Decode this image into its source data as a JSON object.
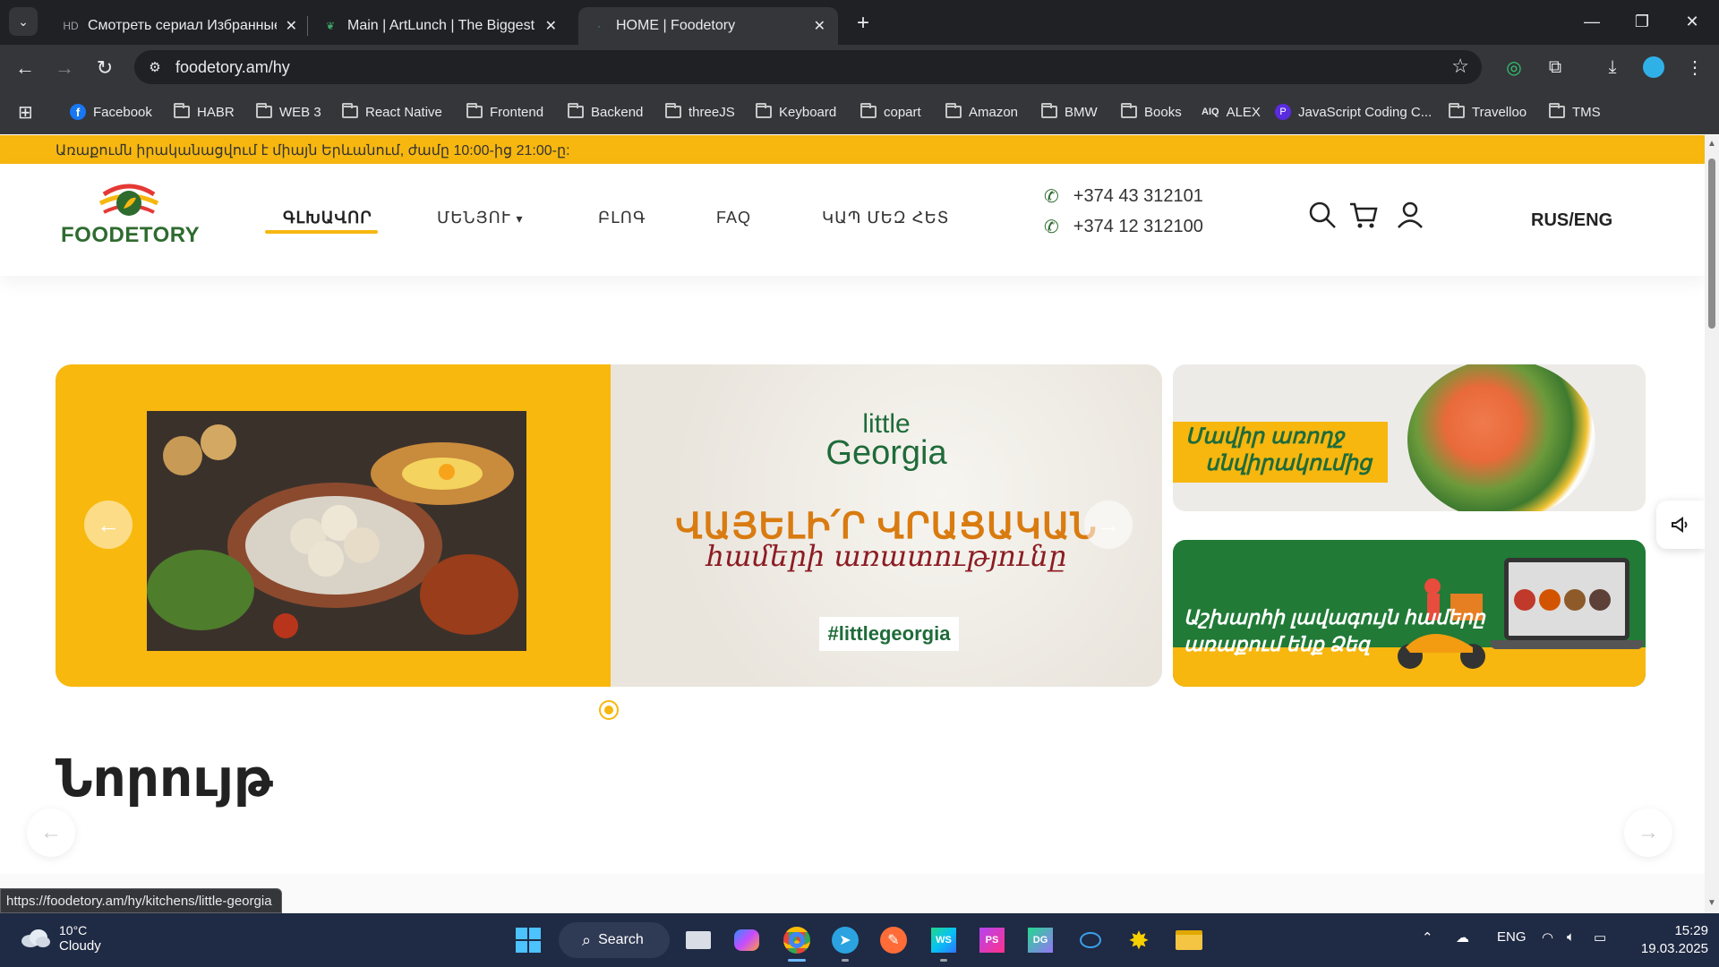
{
  "browser": {
    "tabs": [
      {
        "title": "Смотреть сериал Избранные с",
        "favicon": "hd-icon",
        "active": false
      },
      {
        "title": "Main | ArtLunch | The Biggest C",
        "favicon": "artlunch-icon",
        "active": false
      },
      {
        "title": "HOME | Foodetory",
        "favicon": "foodetory-icon",
        "active": true
      }
    ],
    "url": "foodetory.am/hy",
    "bookmarks": [
      "Facebook",
      "HABR",
      "WEB 3",
      "React Native",
      "Frontend",
      "Backend",
      "threeJS",
      "Keyboard",
      "copart",
      "Amazon",
      "BMW",
      "Books",
      "ALEX",
      "JavaScript Coding C...",
      "Travelloo",
      "TMS"
    ],
    "status_url": "https://foodetory.am/hy/kitchens/little-georgia"
  },
  "site": {
    "announcement": "Առաքումն իրականացվում է միայն Երևանում, ժամը 10:00-ից 21:00-ը:",
    "logo_text": "FOODETORY",
    "nav": [
      "ԳԼԽԱՎՈՐ",
      "ՄԵՆՅՈՒ",
      "ԲԼՈԳ",
      "FAQ",
      "ԿԱՊ ՄԵԶ ՀԵՏ"
    ],
    "phones": [
      "+374 43 312101",
      "+374 12 312100"
    ],
    "lang": "RUS/ENG",
    "slide": {
      "brand_small": "little",
      "brand_big": "Georgia",
      "headline": "ՎԱՅԵԼԻ՛Ր ՎՐԱՑԱԿԱՆ",
      "subline": "համերի առատությունը",
      "hashtag": "#littlegeorgia"
    },
    "banner1_text_1": "Մավիր առողջ",
    "banner1_text_2": "սնվիրակումից",
    "banner2_text_1": "Աշխարհի լավագույն համերը",
    "banner2_text_2": "առաքում ենք Ձեզ",
    "section_title": "Նորույթ"
  },
  "taskbar": {
    "weather_temp": "10°C",
    "weather_cond": "Cloudy",
    "search_label": "Search",
    "lang": "ENG",
    "time": "15:29",
    "date": "19.03.2025"
  },
  "colors": {
    "accent": "#f7b70f",
    "brand_green": "#2e6b2f",
    "chrome_dark": "#202124"
  }
}
